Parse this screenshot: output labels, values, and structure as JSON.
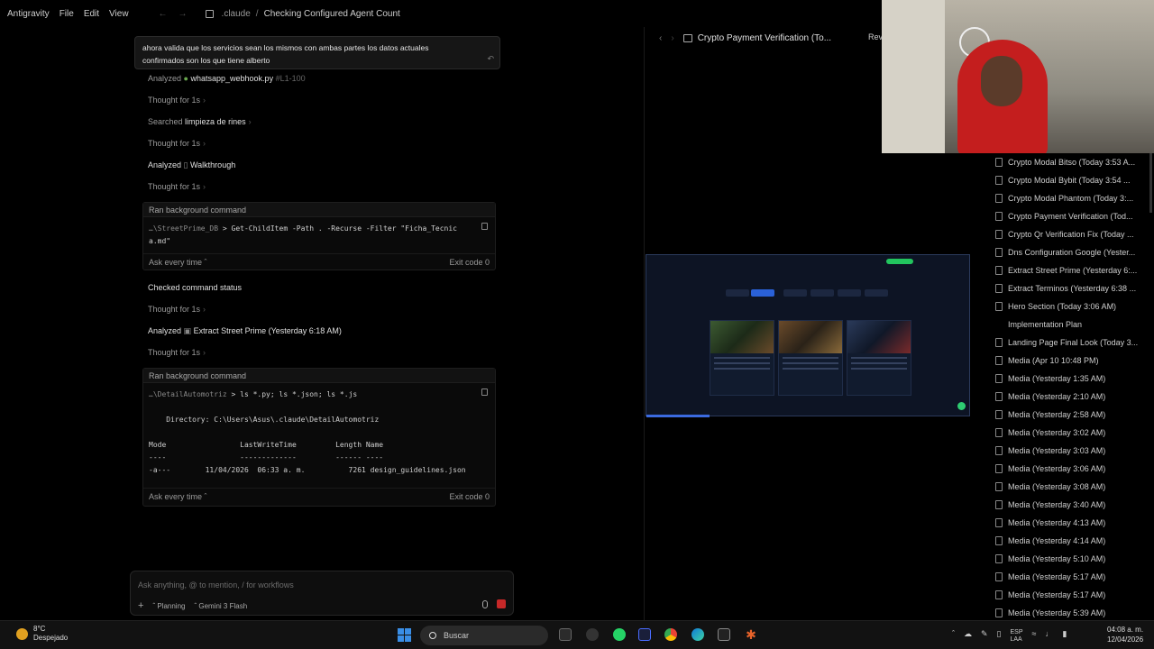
{
  "titlebar": {
    "menu": [
      "Antigravity",
      "File",
      "Edit",
      "View"
    ],
    "breadcrumb": [
      ".claude",
      "Checking Configured Agent Count"
    ]
  },
  "chat": {
    "user_message_line1": "ahora valida que los servicios sean los mismos con ambas partes los datos actuales",
    "user_message_line2": "confirmados son los que tiene alberto",
    "steps": {
      "s1_verb": "Analyzed",
      "s1_obj": "whatsapp_webhook.py",
      "s1_range": "#L1-100",
      "s2": "Thought for 1s",
      "s3_verb": "Searched",
      "s3_obj": "limpieza de rines",
      "s4": "Thought for 1s",
      "s5_verb": "Analyzed",
      "s5_obj": "Walkthrough",
      "s6": "Thought for 1s",
      "s7": "Checked command status",
      "s8": "Thought for 1s",
      "s9_verb": "Analyzed",
      "s9_obj": "Extract Street Prime (Yesterday 6:18 AM)",
      "s10": "Thought for 1s"
    },
    "cmd1": {
      "head": "Ran background command",
      "path": "…\\StreetPrime_DB",
      "command": "Get-ChildItem -Path . -Recurse -Filter \"Ficha_Tecnic",
      "command2": "a.md\"",
      "ask": "Ask every time",
      "exit": "Exit code 0"
    },
    "cmd2": {
      "head": "Ran background command",
      "path": "…\\DetailAutomotriz",
      "command": "ls *.py; ls *.json; ls *.js",
      "dir": "    Directory: C:\\Users\\Asus\\.claude\\DetailAutomotriz",
      "header": "Mode                 LastWriteTime         Length Name",
      "dashes": "----                 -------------         ------ ----",
      "row": "-a---        11/04/2026  06:33 a. m.          7261 design_guidelines.json",
      "ask": "Ask every time",
      "exit": "Exit code 0"
    },
    "input": {
      "placeholder": "Ask anything, @ to mention, / for workflows",
      "mode": "Planning",
      "model": "Gemini 3 Flash"
    }
  },
  "preview": {
    "title": "Crypto Payment Verification (To...",
    "review_tab": "Revi"
  },
  "right_list": {
    "items": [
      "Crypto Modal Bitso (Today 3:53 A...",
      "Crypto Modal Bybit (Today 3:54 ...",
      "Crypto Modal Phantom (Today 3:...",
      "Crypto Payment Verification (Tod...",
      "Crypto Qr Verification Fix (Today ...",
      "Dns Configuration Google (Yester...",
      "Extract Street Prime (Yesterday 6:...",
      "Extract Terminos (Yesterday 6:38 ...",
      "Hero Section (Today 3:06 AM)",
      "Implementation Plan",
      "Landing Page Final Look (Today 3...",
      "Media (Apr 10 10:48 PM)",
      "Media (Yesterday 1:35 AM)",
      "Media (Yesterday 2:10 AM)",
      "Media (Yesterday 2:58 AM)",
      "Media (Yesterday 3:02 AM)",
      "Media (Yesterday 3:03 AM)",
      "Media (Yesterday 3:06 AM)",
      "Media (Yesterday 3:08 AM)",
      "Media (Yesterday 3:40 AM)",
      "Media (Yesterday 4:13 AM)",
      "Media (Yesterday 4:14 AM)",
      "Media (Yesterday 5:10 AM)",
      "Media (Yesterday 5:17 AM)",
      "Media (Yesterday 5:17 AM)",
      "Media (Yesterday 5:39 AM)"
    ]
  },
  "taskbar": {
    "temp": "8°C",
    "weather": "Despejado",
    "search": "Buscar",
    "lang1": "ESP",
    "lang2": "LAA",
    "time": "04:08 a. m.",
    "date": "12/04/2026"
  }
}
